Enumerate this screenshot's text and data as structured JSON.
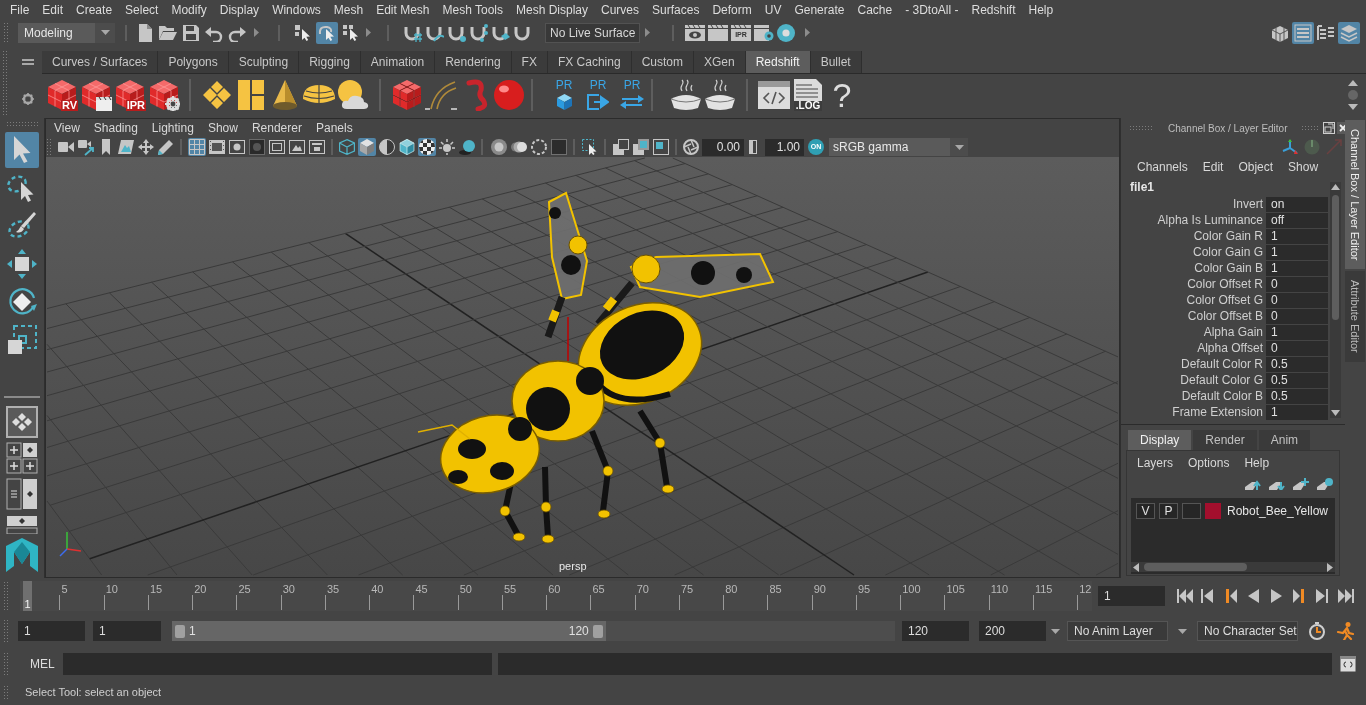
{
  "menu_bar": {
    "items": [
      "File",
      "Edit",
      "Create",
      "Select",
      "Modify",
      "Display",
      "Windows",
      "Mesh",
      "Edit Mesh",
      "Mesh Tools",
      "Mesh Display",
      "Curves",
      "Surfaces",
      "Deform",
      "UV",
      "Generate",
      "Cache",
      "- 3DtoAll -",
      "Redshift",
      "Help"
    ]
  },
  "status_line": {
    "menu_set": "Modeling",
    "selection_modes": [
      {
        "selected": false
      },
      {
        "selected": true
      },
      {
        "selected": false
      }
    ],
    "live_surface": "No Live Surface",
    "render_badge": "IPR",
    "panel_toggles": [
      {
        "selected": false
      },
      {
        "selected": true
      },
      {
        "selected": false
      },
      {
        "selected": true
      }
    ]
  },
  "shelf": {
    "tabs": [
      {
        "label": "Curves / Surfaces",
        "selected": false
      },
      {
        "label": "Polygons",
        "selected": false
      },
      {
        "label": "Sculpting",
        "selected": false
      },
      {
        "label": "Rigging",
        "selected": false
      },
      {
        "label": "Animation",
        "selected": false
      },
      {
        "label": "Rendering",
        "selected": false
      },
      {
        "label": "FX",
        "selected": false
      },
      {
        "label": "FX Caching",
        "selected": false
      },
      {
        "label": "Custom",
        "selected": false
      },
      {
        "label": "XGen",
        "selected": false
      },
      {
        "label": "Redshift",
        "selected": true
      },
      {
        "label": "Bullet",
        "selected": false
      }
    ],
    "button_labels": [
      "RV",
      "IPR",
      "PR",
      "PR",
      "PR",
      ".LOG",
      "?"
    ]
  },
  "toolbox": {
    "tools": [
      {
        "selected": true
      },
      {
        "selected": false
      },
      {
        "selected": false
      },
      {
        "selected": false
      },
      {
        "selected": false
      },
      {
        "selected": false
      }
    ]
  },
  "viewport": {
    "menu": [
      "View",
      "Shading",
      "Lighting",
      "Show",
      "Renderer",
      "Panels"
    ],
    "toolbar_buttons": [
      {
        "selected": false
      },
      {
        "selected": false
      },
      {
        "selected": false
      },
      {
        "selected": false
      },
      {
        "selected": false
      },
      {
        "selected": false
      },
      {
        "selected": true
      },
      {
        "selected": false
      },
      {
        "selected": false
      },
      {
        "selected": false
      },
      {
        "selected": false
      },
      {
        "selected": false
      },
      {
        "selected": false
      },
      {
        "selected": false
      },
      {
        "selected": true
      },
      {
        "selected": false
      },
      {
        "selected": false
      },
      {
        "selected": true
      },
      {
        "selected": false
      },
      {
        "selected": false
      },
      {
        "selected": false
      },
      {
        "selected": false
      },
      {
        "selected": false
      },
      {
        "selected": false
      },
      {
        "selected": false
      },
      {
        "selected": false
      },
      {
        "selected": false
      },
      {
        "selected": false
      }
    ],
    "exposure": "0.00",
    "gamma": "1.00",
    "color_management": {
      "label": "ON",
      "on": true
    },
    "color_space": "sRGB gamma",
    "camera": "persp"
  },
  "channel_box": {
    "title": "Channel Box / Layer Editor",
    "menu": [
      "Channels",
      "Edit",
      "Object",
      "Show"
    ],
    "node": "file1",
    "attributes": [
      {
        "name": "Invert",
        "value": "on"
      },
      {
        "name": "Alpha Is Luminance",
        "value": "off"
      },
      {
        "name": "Color Gain R",
        "value": "1"
      },
      {
        "name": "Color Gain G",
        "value": "1"
      },
      {
        "name": "Color Gain B",
        "value": "1"
      },
      {
        "name": "Color Offset R",
        "value": "0"
      },
      {
        "name": "Color Offset G",
        "value": "0"
      },
      {
        "name": "Color Offset B",
        "value": "0"
      },
      {
        "name": "Alpha Gain",
        "value": "1"
      },
      {
        "name": "Alpha Offset",
        "value": "0"
      },
      {
        "name": "Default Color R",
        "value": "0.5"
      },
      {
        "name": "Default Color G",
        "value": "0.5"
      },
      {
        "name": "Default Color B",
        "value": "0.5"
      },
      {
        "name": "Frame Extension",
        "value": "1"
      }
    ]
  },
  "layer_editor": {
    "tabs": [
      {
        "label": "Display",
        "selected": true
      },
      {
        "label": "Render",
        "selected": false
      },
      {
        "label": "Anim",
        "selected": false
      }
    ],
    "menu": [
      "Layers",
      "Options",
      "Help"
    ],
    "layers": [
      {
        "visibility": "V",
        "playback": "P",
        "name": "Robot_Bee_Yellow",
        "color": "#a30f2d"
      }
    ]
  },
  "side_tabs": [
    {
      "label": "Channel Box / Layer Editor",
      "selected": true
    },
    {
      "label": "Attribute Editor",
      "selected": false
    }
  ],
  "timeline": {
    "ticks": [
      "5",
      "10",
      "15",
      "20",
      "25",
      "30",
      "35",
      "40",
      "45",
      "50",
      "55",
      "60",
      "65",
      "70",
      "75",
      "80",
      "85",
      "90",
      "95",
      "100",
      "105",
      "110",
      "115",
      "12"
    ],
    "current_frame_marker": "1",
    "level": 0,
    "current_frame": "1"
  },
  "range_slider": {
    "start": "1",
    "playback_start": "1",
    "slider_start": "1",
    "slider_end": "120",
    "level": 0.6,
    "playback_end": "120",
    "end": "200",
    "anim_layer": "No Anim Layer",
    "character_set": "No Character Set"
  },
  "command_line": {
    "language": "MEL"
  },
  "help_line": "Select Tool: select an object"
}
